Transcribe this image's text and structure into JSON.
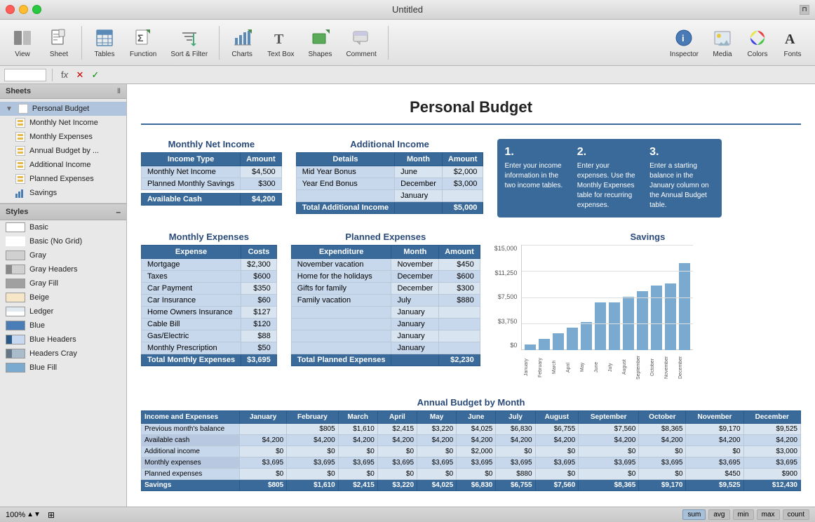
{
  "titlebar": {
    "title": "Untitled"
  },
  "toolbar": {
    "items": [
      {
        "id": "view",
        "label": "View",
        "icon": "◧"
      },
      {
        "id": "sheet",
        "label": "Sheet",
        "icon": "📋"
      },
      {
        "id": "tables",
        "label": "Tables",
        "icon": "⊞"
      },
      {
        "id": "function",
        "label": "Function",
        "icon": "Σ"
      },
      {
        "id": "sort-filter",
        "label": "Sort & Filter",
        "icon": "⇅"
      },
      {
        "id": "charts",
        "label": "Charts",
        "icon": "📊"
      },
      {
        "id": "text-box",
        "label": "Text Box",
        "icon": "T"
      },
      {
        "id": "shapes",
        "label": "Shapes",
        "icon": "⬜"
      },
      {
        "id": "comment",
        "label": "Comment",
        "icon": "💬"
      },
      {
        "id": "inspector",
        "label": "Inspector",
        "icon": "ℹ"
      },
      {
        "id": "media",
        "label": "Media",
        "icon": "🖼"
      },
      {
        "id": "colors",
        "label": "Colors",
        "icon": "🎨"
      },
      {
        "id": "fonts",
        "label": "Fonts",
        "icon": "A"
      }
    ]
  },
  "formulabar": {
    "cell_ref": "",
    "formula": ""
  },
  "sheets_panel": {
    "header": "Sheets",
    "items": [
      {
        "id": "personal-budget",
        "label": "Personal Budget",
        "type": "folder",
        "active": true
      },
      {
        "id": "monthly-net-income",
        "label": "Monthly Net Income",
        "type": "spreadsheet"
      },
      {
        "id": "monthly-expenses",
        "label": "Monthly Expenses",
        "type": "spreadsheet"
      },
      {
        "id": "annual-budget",
        "label": "Annual Budget by ...",
        "type": "spreadsheet"
      },
      {
        "id": "additional-income",
        "label": "Additional Income",
        "type": "spreadsheet"
      },
      {
        "id": "planned-expenses",
        "label": "Planned Expenses",
        "type": "spreadsheet"
      },
      {
        "id": "savings",
        "label": "Savings",
        "type": "bar-chart"
      }
    ]
  },
  "styles_panel": {
    "header": "Styles",
    "items": [
      {
        "id": "basic",
        "label": "Basic",
        "style": "basic"
      },
      {
        "id": "basic-no-grid",
        "label": "Basic (No Grid)",
        "style": "basic-nogrid"
      },
      {
        "id": "gray",
        "label": "Gray",
        "style": "gray"
      },
      {
        "id": "gray-headers",
        "label": "Gray Headers",
        "style": "gray-headers"
      },
      {
        "id": "gray-fill",
        "label": "Gray Fill",
        "style": "gray-fill"
      },
      {
        "id": "beige",
        "label": "Beige",
        "style": "beige"
      },
      {
        "id": "ledger",
        "label": "Ledger",
        "style": "ledger"
      },
      {
        "id": "blue",
        "label": "Blue",
        "style": "blue"
      },
      {
        "id": "blue-headers",
        "label": "Blue Headers",
        "style": "blue-headers"
      },
      {
        "id": "headers-cray",
        "label": "Headers Cray",
        "style": "headers-cray"
      },
      {
        "id": "blue-fill",
        "label": "Blue Fill",
        "style": "blue-fill"
      }
    ]
  },
  "spreadsheet": {
    "title": "Personal Budget",
    "monthly_net_income": {
      "title": "Monthly Net Income",
      "headers": [
        "Income Type",
        "Amount"
      ],
      "rows": [
        [
          "Monthly Net Income",
          "$4,500"
        ],
        [
          "Planned Monthly Savings",
          "$300"
        ]
      ],
      "footer": [
        "Available Cash",
        "$4,200"
      ]
    },
    "additional_income": {
      "title": "Additional Income",
      "headers": [
        "Details",
        "Month",
        "Amount"
      ],
      "rows": [
        [
          "Mid Year Bonus",
          "June",
          "$2,000"
        ],
        [
          "Year End Bonus",
          "December",
          "$3,000"
        ],
        [
          "",
          "January",
          ""
        ]
      ],
      "footer": [
        "Total Additional Income",
        "",
        "$5,000"
      ]
    },
    "instructions": [
      {
        "num": "1.",
        "text": "Enter your income information in the two income tables."
      },
      {
        "num": "2.",
        "text": "Enter your expenses. Use the Monthly Expenses table for recurring expenses."
      },
      {
        "num": "3.",
        "text": "Enter a starting balance in the January column on the Annual Budget table."
      }
    ],
    "monthly_expenses": {
      "title": "Monthly Expenses",
      "headers": [
        "Expense",
        "Costs"
      ],
      "rows": [
        [
          "Mortgage",
          "$2,300"
        ],
        [
          "Taxes",
          "$600"
        ],
        [
          "Car Payment",
          "$350"
        ],
        [
          "Car Insurance",
          "$60"
        ],
        [
          "Home Owners Insurance",
          "$127"
        ],
        [
          "Cable Bill",
          "$120"
        ],
        [
          "Gas/Electric",
          "$88"
        ],
        [
          "Monthly Prescription",
          "$50"
        ]
      ],
      "footer": [
        "Total Monthly Expenses",
        "$3,695"
      ]
    },
    "planned_expenses": {
      "title": "Planned Expenses",
      "headers": [
        "Expenditure",
        "Month",
        "Amount"
      ],
      "rows": [
        [
          "November vacation",
          "November",
          "$450"
        ],
        [
          "Home for the holidays",
          "December",
          "$600"
        ],
        [
          "Gifts for family",
          "December",
          "$300"
        ],
        [
          "Family vacation",
          "July",
          "$880"
        ],
        [
          "",
          "January",
          ""
        ],
        [
          "",
          "January",
          ""
        ],
        [
          "",
          "January",
          ""
        ],
        [
          "",
          "January",
          ""
        ]
      ],
      "footer": [
        "Total Planned Expenses",
        "",
        "$2,230"
      ]
    },
    "savings": {
      "title": "Savings",
      "bars": [
        805,
        1610,
        2415,
        3220,
        4025,
        6830,
        6755,
        7560,
        8365,
        9170,
        9525,
        12430
      ],
      "max": 15000,
      "y_labels": [
        "$15,000",
        "$11,250",
        "$7,500",
        "$3,750",
        "$0"
      ],
      "x_labels": [
        "January",
        "February",
        "March",
        "April",
        "May",
        "June",
        "July",
        "August",
        "September",
        "October",
        "November",
        "December"
      ]
    },
    "annual_budget": {
      "title": "Annual Budget by Month",
      "headers": [
        "Income and Expenses",
        "January",
        "February",
        "March",
        "April",
        "May",
        "June",
        "July",
        "August",
        "September",
        "October",
        "November",
        "December"
      ],
      "rows": [
        [
          "Previous month's balance",
          "",
          "$805",
          "$1,610",
          "$2,415",
          "$3,220",
          "$4,025",
          "$6,830",
          "$6,755",
          "$7,560",
          "$8,365",
          "$9,170",
          "$9,525"
        ],
        [
          "Available cash",
          "$4,200",
          "$4,200",
          "$4,200",
          "$4,200",
          "$4,200",
          "$4,200",
          "$4,200",
          "$4,200",
          "$4,200",
          "$4,200",
          "$4,200",
          "$4,200"
        ],
        [
          "Additional income",
          "$0",
          "$0",
          "$0",
          "$0",
          "$0",
          "$2,000",
          "$0",
          "$0",
          "$0",
          "$0",
          "$0",
          "$3,000"
        ],
        [
          "Monthly expenses",
          "$3,695",
          "$3,695",
          "$3,695",
          "$3,695",
          "$3,695",
          "$3,695",
          "$3,695",
          "$3,695",
          "$3,695",
          "$3,695",
          "$3,695",
          "$3,695"
        ],
        [
          "Planned expenses",
          "$0",
          "$0",
          "$0",
          "$0",
          "$0",
          "$0",
          "$880",
          "$0",
          "$0",
          "$0",
          "$450",
          "$900"
        ]
      ],
      "savings_row": [
        "Savings",
        "$805",
        "$1,610",
        "$2,415",
        "$3,220",
        "$4,025",
        "$6,830",
        "$6,755",
        "$7,560",
        "$8,365",
        "$9,170",
        "$9,525",
        "$12,430"
      ]
    }
  },
  "statusbar": {
    "zoom": "100%",
    "functions": [
      "sum",
      "avg",
      "min",
      "max",
      "count"
    ]
  }
}
